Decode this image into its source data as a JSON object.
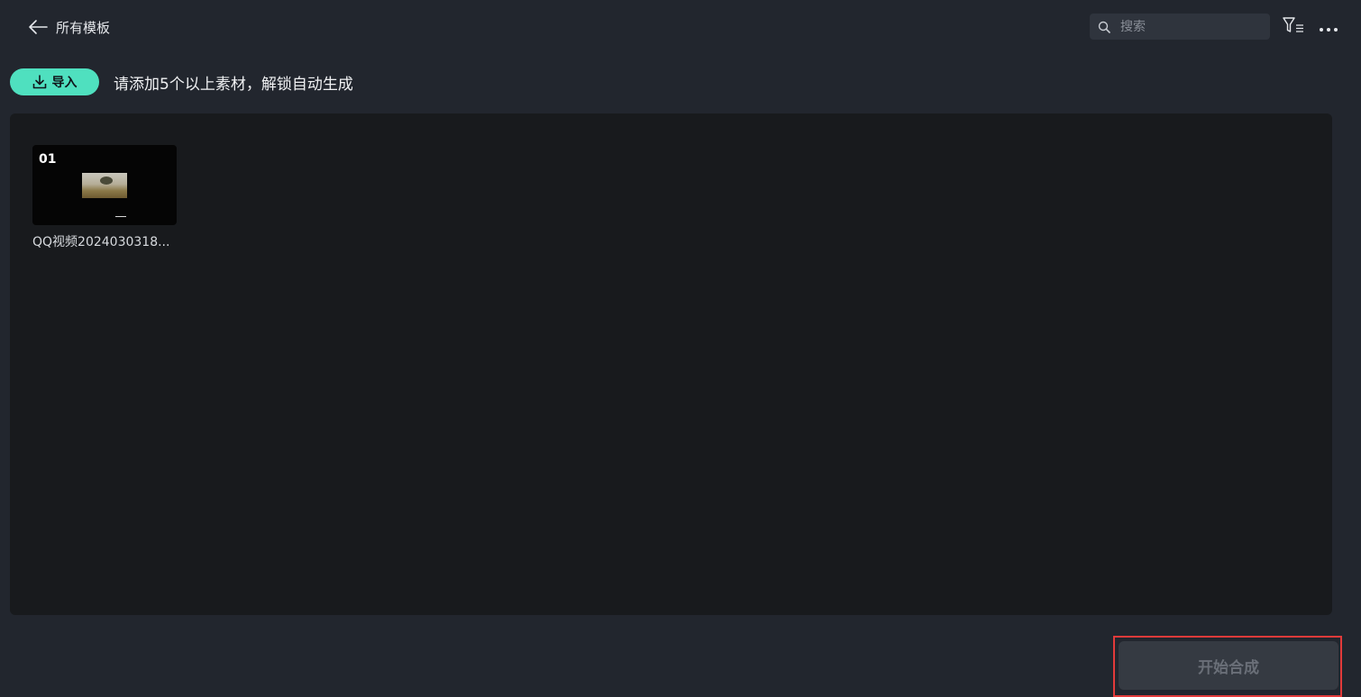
{
  "header": {
    "back_label": "所有模板",
    "search_placeholder": "搜索"
  },
  "icons": {
    "back": "arrow-left-icon",
    "search": "search-icon",
    "filter": "filter-list-icon",
    "more": "more-horizontal-icon",
    "import": "download-icon"
  },
  "toolbar": {
    "import_label": "导入",
    "hint": "请添加5个以上素材，解锁自动生成"
  },
  "materials": [
    {
      "index": "01",
      "name": "QQ视频2024030318..."
    }
  ],
  "footer": {
    "start_label": "开始合成"
  },
  "colors": {
    "accent": "#4fe0bf",
    "background": "#22262e",
    "panel": "#181a1d",
    "highlight": "#e23a3a"
  }
}
